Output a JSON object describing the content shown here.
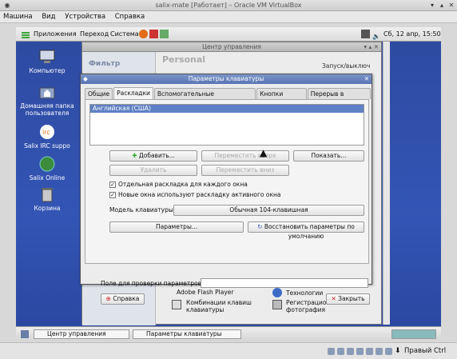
{
  "vbox": {
    "title": "salix-mate [Работает] – Oracle VM VirtualBox",
    "menu": [
      "Машина",
      "Вид",
      "Устройства",
      "Справка"
    ],
    "host_key": "Правый Ctrl"
  },
  "guest_panel": {
    "apps": "Приложения",
    "places": "Переход",
    "system": "Система",
    "clock": "Сб, 12 апр, 15:50"
  },
  "desktop_icons": [
    {
      "label": "Компьютер",
      "icon": "computer-icon"
    },
    {
      "label": "Домашняя папка пользователя",
      "icon": "home-folder-icon"
    },
    {
      "label": "Salix IRC suppo",
      "icon": "irc-icon"
    },
    {
      "label": "Salix Online",
      "icon": "globe-icon"
    },
    {
      "label": "Корзина",
      "icon": "trash-icon"
    }
  ],
  "control_center": {
    "title": "Центр управления",
    "filter_label": "Фильтр",
    "section": "Personal",
    "top_item": "Запуск/выключ",
    "items": [
      "Adobe Flash Player",
      "Технологии",
      "Комбинации клавиш клавиатуры",
      "Регистрационная фотография"
    ]
  },
  "dialog": {
    "title": "Параметры клавиатуры",
    "tabs": [
      "Общие",
      "Раскладки",
      "Вспомогательные технологии",
      "Кнопки мыши",
      "Перерыв в работе"
    ],
    "active_tab": "Раскладки",
    "layouts": [
      "Английская (США)"
    ],
    "buttons": {
      "add": "Добавить...",
      "move_up": "Переместить вверх",
      "show": "Показать...",
      "remove": "Удалить",
      "move_down": "Переместить вниз",
      "options": "Параметры...",
      "reset": "Восстановить параметры по умолчанию",
      "help": "Справка",
      "close": "Закрыть"
    },
    "checks": {
      "separate": "Отдельная раскладка для каждого окна",
      "new_windows": "Новые окна используют раскладку активного окна"
    },
    "model_label": "Модель клавиатуры:",
    "model_value": "Обычная 104-клавишная",
    "test_label": "Поле для проверки параметров:"
  },
  "taskbar": {
    "items": [
      "Центр управления",
      "Параметры клавиатуры"
    ]
  },
  "colors": {
    "desktop": "#2e4aa0",
    "dialog_title": "#5874b4",
    "selection": "#5f80c4"
  }
}
